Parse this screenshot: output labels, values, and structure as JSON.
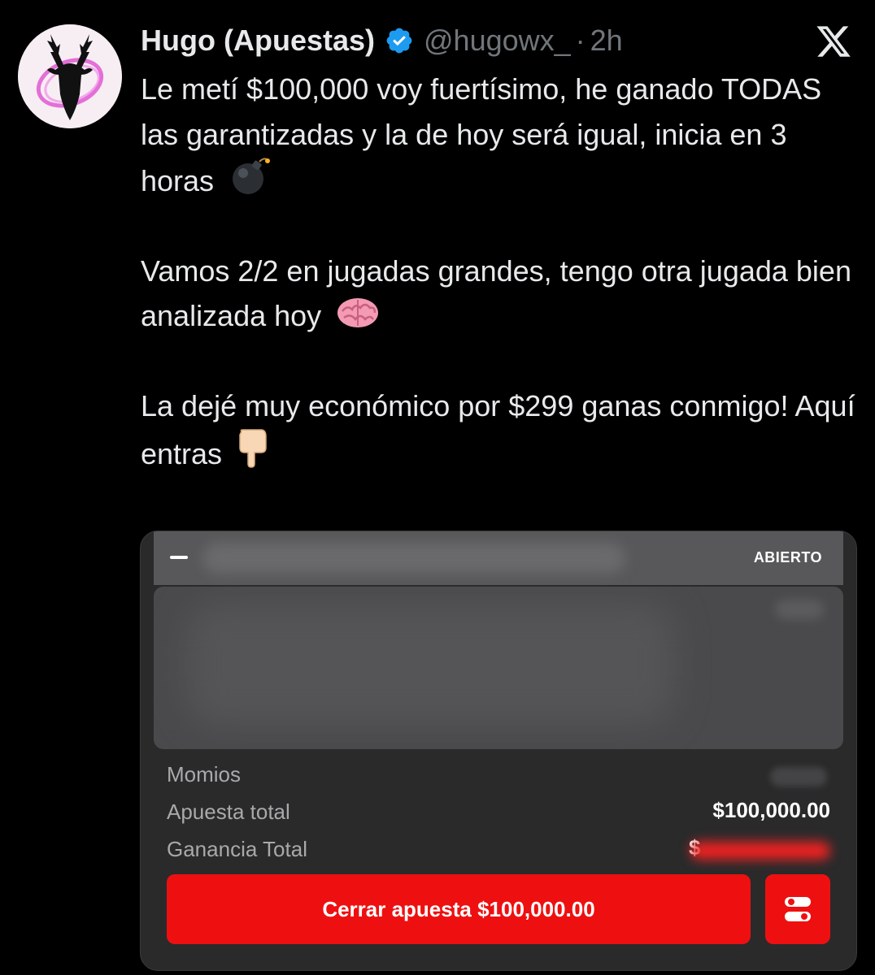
{
  "tweet": {
    "author": {
      "display_name": "Hugo (Apuestas)",
      "handle": "@hugowx_",
      "verified": true,
      "avatar_icon": "deer-head-silhouette-icon"
    },
    "separator": "·",
    "time": "2h",
    "platform_icon": "x-logo-icon",
    "text": {
      "p1": "Le metí $100,000 voy fuertísimo, he ganado TODAS las garantizadas y la de hoy será igual, inicia en 3 horas",
      "p2": "Vamos 2/2 en jugadas grandes, tengo otra jugada bien analizada hoy",
      "p3": "La dejé muy económico por $299 ganas conmigo! Aquí entras"
    },
    "emojis": {
      "p1": "bomb-emoji",
      "p2": "brain-emoji",
      "p3": "pointing-down-emoji"
    }
  },
  "bet_slip": {
    "status": "ABIERTO",
    "rows": {
      "odds_label": "Momios",
      "stake_label": "Apuesta total",
      "stake_value": "$100,000.00",
      "payout_label": "Ganancia Total",
      "payout_prefix": "$"
    },
    "cashout_button": "Cerrar apuesta $100,000.00",
    "colors": {
      "accent": "#ee1010",
      "header": "#58585a",
      "card": "#2a2a2b"
    }
  },
  "colors": {
    "background": "#000000",
    "verified_blue": "#1d9bf0",
    "muted_text": "#71767b"
  }
}
